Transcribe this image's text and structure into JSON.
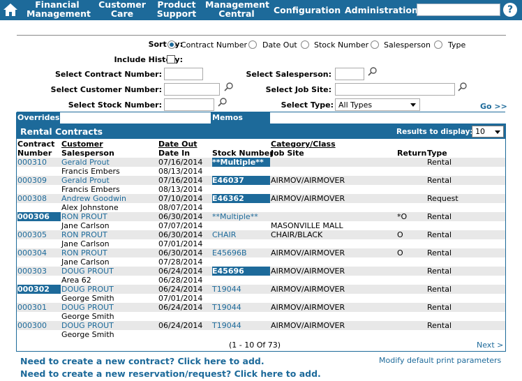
{
  "nav": {
    "items": [
      {
        "line1": "Financial",
        "line2": "Management"
      },
      {
        "line1": "Customer",
        "line2": "Care"
      },
      {
        "line1": "Product",
        "line2": "Support"
      },
      {
        "line1": "Management",
        "line2": "Central"
      },
      {
        "line1": "Configuration",
        "line2": ""
      },
      {
        "line1": "Administration",
        "line2": ""
      }
    ],
    "search_value": "",
    "help_glyph": "?"
  },
  "form": {
    "sort_by_label": "Sort by:",
    "sort_options": [
      "Contract Number",
      "Date Out",
      "Stock Number",
      "Salesperson",
      "Type"
    ],
    "sort_selected": "Contract Number",
    "include_history_label": "Include History:",
    "select_contract_label": "Select Contract Number:",
    "select_customer_label": "Select Customer Number:",
    "select_stock_label": "Select Stock Number:",
    "select_salesperson_label": "Select Salesperson:",
    "select_jobsite_label": "Select Job Site:",
    "select_type_label": "Select Type:",
    "select_type_value": "All Types",
    "go_label": "Go >>"
  },
  "bars": {
    "overrides": "Overrides",
    "memos": "Memos"
  },
  "panel": {
    "title": "Rental Contracts",
    "results_label": "Results to display:",
    "results_value": "10",
    "headers": {
      "contract_number_1": "Contract",
      "contract_number_2": "Number",
      "customer": "Customer",
      "salesperson": "Salesperson",
      "date_out": "Date Out",
      "date_in": "Date In",
      "stock_number": "Stock Number",
      "category_class": "Category/Class",
      "job_site": "Job Site",
      "return": "Return",
      "type": "Type"
    },
    "rows": [
      {
        "contract": "000310",
        "customer": "Gerald Prout",
        "salesperson": "Francis Embers",
        "date_out": "07/16/2014",
        "date_in": "08/13/2014",
        "stock": "**Multiple**",
        "category": "",
        "job_site": "",
        "return": "",
        "type": "Rental",
        "contract_hl": false,
        "stock_hl": true
      },
      {
        "contract": "000309",
        "customer": "Gerald Prout",
        "salesperson": "Francis Embers",
        "date_out": "07/16/2014",
        "date_in": "08/13/2014",
        "stock": "E46037",
        "category": "AIRMOV/AIRMOVER",
        "job_site": "",
        "return": "",
        "type": "Rental",
        "contract_hl": false,
        "stock_hl": true
      },
      {
        "contract": "000308",
        "customer": "Andrew Goodwin",
        "salesperson": "Alex Johnstone",
        "date_out": "07/10/2014",
        "date_in": "08/07/2014",
        "stock": "E46362",
        "category": "AIRMOV/AIRMOVER",
        "job_site": "",
        "return": "",
        "type": "Request",
        "contract_hl": false,
        "stock_hl": true
      },
      {
        "contract": "000306",
        "customer": "RON PROUT",
        "salesperson": "Jane Carlson",
        "date_out": "06/30/2014",
        "date_in": "07/07/2014",
        "stock": "**Multiple**",
        "category": "",
        "job_site": "MASONVILLE MALL",
        "return": "*O",
        "type": "Rental",
        "contract_hl": true,
        "stock_hl": false
      },
      {
        "contract": "000305",
        "customer": "RON PROUT",
        "salesperson": "Jane Carlson",
        "date_out": "06/30/2014",
        "date_in": "07/01/2014",
        "stock": "CHAIR",
        "category": "CHAIR/BLACK",
        "job_site": "",
        "return": "O",
        "type": "Rental",
        "contract_hl": false,
        "stock_hl": false
      },
      {
        "contract": "000304",
        "customer": "RON PROUT",
        "salesperson": "Jane Carlson",
        "date_out": "06/30/2014",
        "date_in": "07/28/2014",
        "stock": "E45696B",
        "category": "AIRMOV/AIRMOVER",
        "job_site": "",
        "return": "O",
        "type": "Rental",
        "contract_hl": false,
        "stock_hl": false
      },
      {
        "contract": "000303",
        "customer": "DOUG PROUT",
        "salesperson": "Area 62",
        "date_out": "06/24/2014",
        "date_in": "06/28/2014",
        "stock": "E45696",
        "category": "AIRMOV/AIRMOVER",
        "job_site": "",
        "return": "",
        "type": "Rental",
        "contract_hl": false,
        "stock_hl": true
      },
      {
        "contract": "000302",
        "customer": "DOUG PROUT",
        "salesperson": "George Smith",
        "date_out": "06/24/2014",
        "date_in": "07/01/2014",
        "stock": "T19044",
        "category": "AIRMOV/AIRMOVER",
        "job_site": "",
        "return": "",
        "type": "Rental",
        "contract_hl": true,
        "stock_hl": false
      },
      {
        "contract": "000301",
        "customer": "DOUG PROUT",
        "salesperson": "George Smith",
        "date_out": "06/24/2014",
        "date_in": "",
        "stock": "T19044",
        "category": "AIRMOV/AIRMOVER",
        "job_site": "",
        "return": "",
        "type": "Rental",
        "contract_hl": false,
        "stock_hl": false
      },
      {
        "contract": "000300",
        "customer": "DOUG PROUT",
        "salesperson": "George Smith",
        "date_out": "06/24/2014",
        "date_in": "",
        "stock": "T19044",
        "category": "AIRMOV/AIRMOVER",
        "job_site": "",
        "return": "",
        "type": "Rental",
        "contract_hl": false,
        "stock_hl": false
      }
    ],
    "pager": "(1  -  10  Of  73)",
    "next": "Next >"
  },
  "footer": {
    "new_contract": "Need to create a new contract? Click here to add.",
    "new_reservation": "Need to create a new reservation/request? Click here to add.",
    "modify_print": "Modify default print parameters"
  },
  "colors": {
    "brand": "#1d6a9a",
    "row_shade": "#e8e8e8"
  }
}
